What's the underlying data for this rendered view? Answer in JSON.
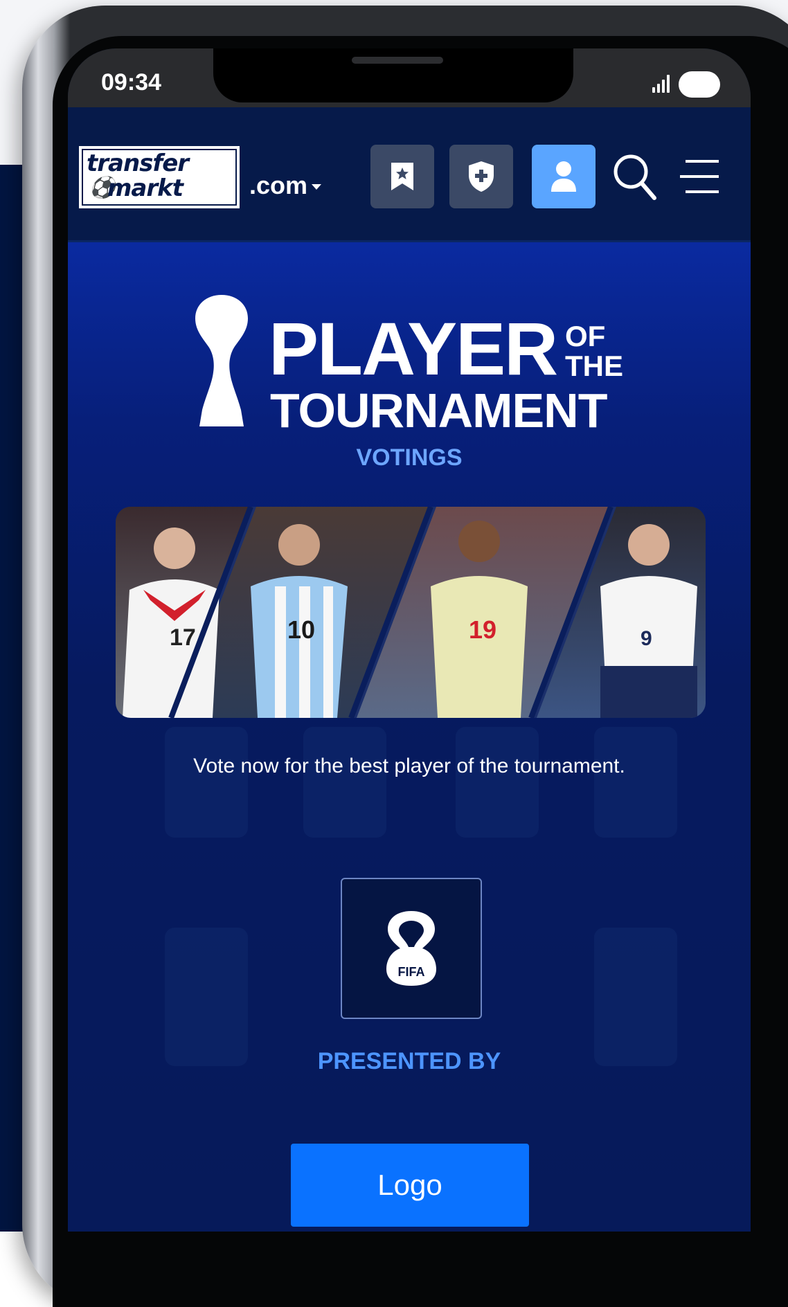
{
  "status_bar": {
    "time": "09:34"
  },
  "header": {
    "logo_line1": "transfer",
    "logo_line2": "markt",
    "domain": ".com"
  },
  "hero": {
    "title_main": "PLAYER",
    "title_of": "OF",
    "title_the": "THE",
    "title_sub": "TOURNAMENT",
    "subtitle": "VOTINGS",
    "description": "Vote now for the best player of the tournament.",
    "partner_label": "FIFA",
    "presented_by": "PRESENTED BY",
    "logo_button": "Logo",
    "player_numbers": [
      "17",
      "10",
      "19",
      "9"
    ]
  },
  "colors": {
    "accent_blue": "#0a72ff",
    "navy": "#061a4a",
    "active_nav": "#5aa5ff"
  },
  "icons": [
    "bookmark-star-icon",
    "shield-plus-icon",
    "user-icon",
    "search-icon",
    "hamburger-menu-icon",
    "trophy-icon",
    "fifa-logo-icon"
  ]
}
